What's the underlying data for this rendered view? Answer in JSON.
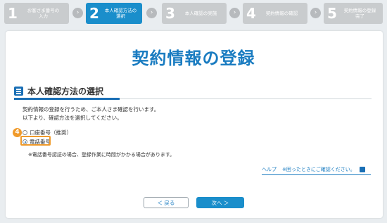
{
  "steps": [
    {
      "num": "1",
      "label": "お客さま番号の\n入力"
    },
    {
      "num": "2",
      "label": "本人確認方法の\n選択",
      "active": true
    },
    {
      "num": "3",
      "label": "本人確認の実施"
    },
    {
      "num": "4",
      "label": "契約情報の確認"
    },
    {
      "num": "5",
      "label": "契約情報の登録\n完了"
    }
  ],
  "arrow_glyph": "›",
  "page_title": "契約情報の登録",
  "section": {
    "title": "本人確認方法の選択",
    "icon": "list-icon"
  },
  "description": [
    "契約情報の登録を行うため、ご本人さま確認を行います。",
    "以下より、確認方法を選択してください。"
  ],
  "options": [
    {
      "label": "口座番号（推奨）",
      "checked": false
    },
    {
      "label": "電話番号",
      "checked": true
    }
  ],
  "callout_number": "4",
  "note": "※電話番号認証の場合、登録作業に時間がかかる場合があります。",
  "help": {
    "link": "ヘルプ",
    "text": "※困ったときにご確認ください。",
    "icon": "external-link-icon"
  },
  "buttons": {
    "back": "＜ 戻る",
    "next": "次へ ＞"
  },
  "colors": {
    "primary": "#1a8ecb",
    "title": "#1a7cc1",
    "highlight": "#f09a2a",
    "inactive_step": "#c9ccce"
  }
}
